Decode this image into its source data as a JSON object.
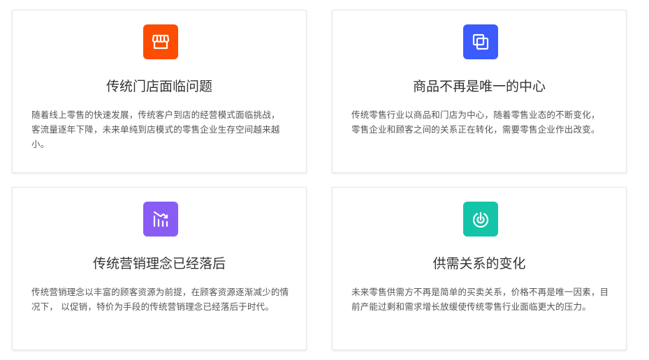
{
  "cards": [
    {
      "title": "传统门店面临问题",
      "description": "随着线上零售的快速发展，传统客户到店的经营模式面临挑战， 客流量逐年下降，未来单纯到店模式的零售企业生存空间越来越小。",
      "icon": "storefront-icon",
      "icon_color": "#fc4d02"
    },
    {
      "title": "商品不再是唯一的中心",
      "description": "传统零售行业以商品和门店为中心，随着零售业态的不断变化， 零售企业和顾客之间的关系正在转化，需要零售企业作出改变。",
      "icon": "layers-icon",
      "icon_color": "#3b5bfd"
    },
    {
      "title": "传统营销理念已经落后",
      "description": "传统营销理念以丰富的顾客资源为前提，在顾客资源逐渐减少的情况下， 以促销，特价为手段的传统营销理念已经落后于时代。",
      "icon": "declining-chart-icon",
      "icon_color": "#8a5cf6"
    },
    {
      "title": "供需关系的变化",
      "description": "未来零售供需方不再是简单的买卖关系，价格不再是唯一因素，目前产能过剩和需求增长放缓使传统零售行业面临更大的压力。",
      "icon": "target-icon",
      "icon_color": "#14c4a8"
    }
  ]
}
